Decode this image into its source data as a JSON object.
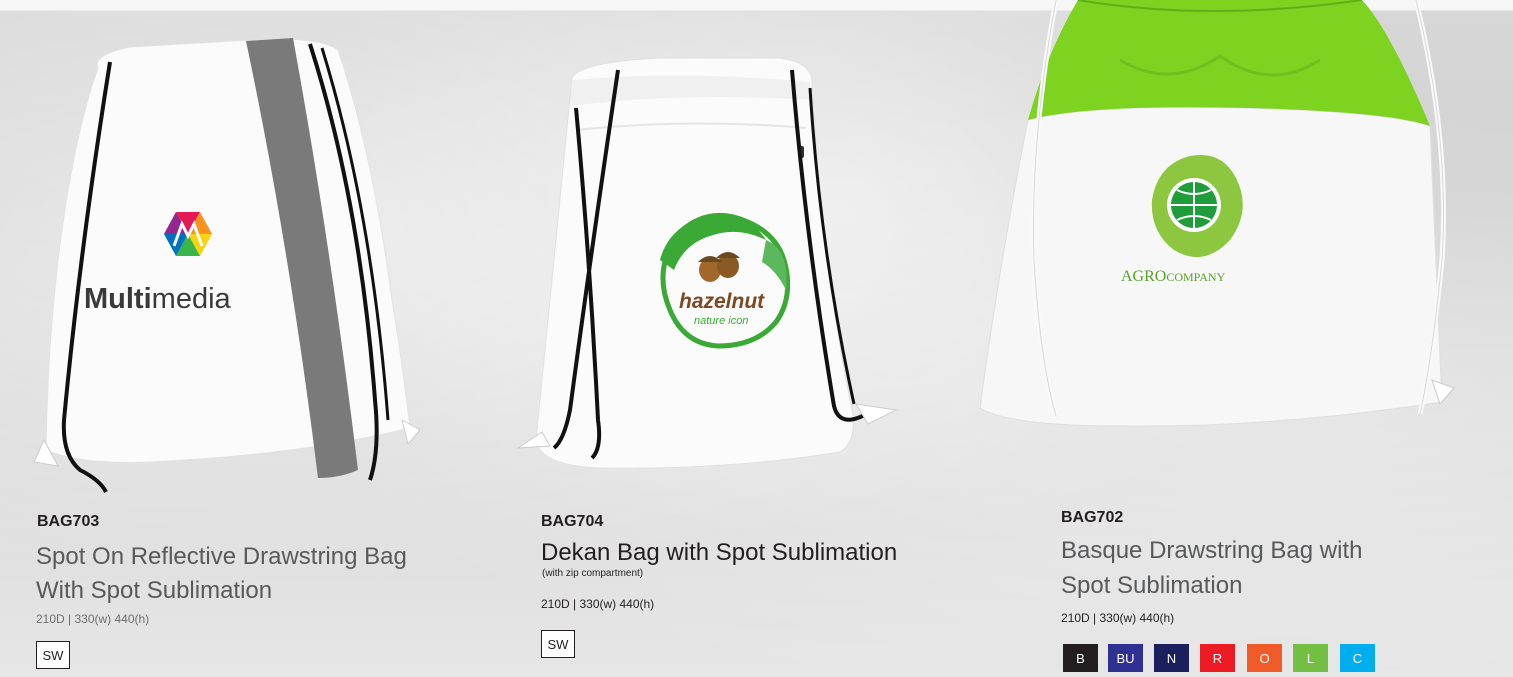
{
  "products": [
    {
      "code": "BAG703",
      "name_lines": [
        "Spot On Reflective Drawstring Bag",
        "With Spot Sublimation"
      ],
      "subtitle": "",
      "spec": "210D | 330(w) 440(h)",
      "logo_word_bold": "Multi",
      "logo_word_light": "media",
      "colors": [
        {
          "label": "SW",
          "color": "#ffffff"
        }
      ]
    },
    {
      "code": "BAG704",
      "name_lines": [
        "Dekan Bag with Spot Sublimation"
      ],
      "subtitle": "(with zip compartment)",
      "spec": "210D | 330(w) 440(h)",
      "logo_word_1": "hazelnut",
      "logo_word_2": "nature icon",
      "colors": [
        {
          "label": "SW",
          "color": "#ffffff"
        }
      ]
    },
    {
      "code": "BAG702",
      "name_lines": [
        "Basque Drawstring Bag with",
        "Spot Sublimation"
      ],
      "subtitle": "",
      "spec": "210D | 330(w) 440(h)",
      "logo_word_bold": "AGRO",
      "logo_word_light": "COMPANY",
      "colors": [
        {
          "label": "B",
          "color": "#231f20"
        },
        {
          "label": "BU",
          "color": "#2e3192"
        },
        {
          "label": "N",
          "color": "#1b1f5e"
        },
        {
          "label": "R",
          "color": "#ed1c24"
        },
        {
          "label": "O",
          "color": "#f15a29"
        },
        {
          "label": "L",
          "color": "#72bf44"
        },
        {
          "label": "C",
          "color": "#00aeef"
        }
      ]
    }
  ]
}
